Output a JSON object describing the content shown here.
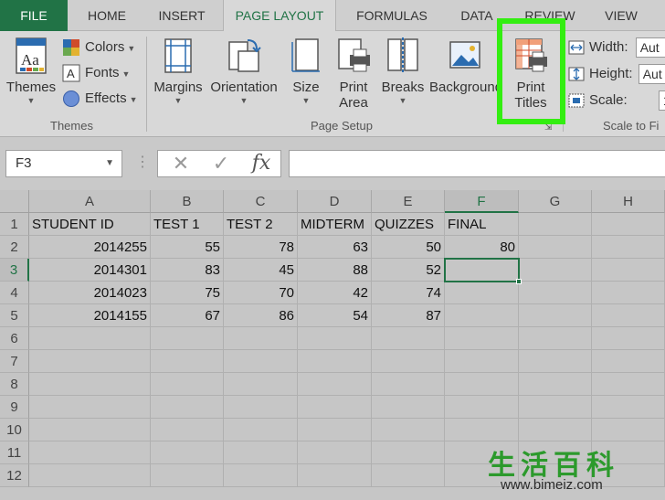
{
  "ribbon_tabs": [
    "FILE",
    "HOME",
    "INSERT",
    "PAGE LAYOUT",
    "FORMULAS",
    "DATA",
    "REVIEW",
    "VIEW"
  ],
  "active_tab": "PAGE LAYOUT",
  "themes_group": {
    "themes_label": "Themes",
    "colors_label": "Colors",
    "fonts_label": "Fonts",
    "effects_label": "Effects",
    "group_label": "Themes"
  },
  "page_setup_group": {
    "margins_label": "Margins",
    "orientation_label": "Orientation",
    "size_label": "Size",
    "print_area_line1": "Print",
    "print_area_line2": "Area",
    "breaks_label": "Breaks",
    "background_label": "Background",
    "print_titles_line1": "Print",
    "print_titles_line2": "Titles",
    "group_label": "Page Setup"
  },
  "scale_group": {
    "width_label": "Width:",
    "width_value": "Aut",
    "height_label": "Height:",
    "height_value": "Aut",
    "scale_label": "Scale:",
    "scale_value": "1",
    "group_label": "Scale to Fi"
  },
  "formula_bar": {
    "name_box": "F3",
    "cancel_symbol": "✕",
    "enter_symbol": "✓",
    "fx_symbol": "fx",
    "content": ""
  },
  "sheet": {
    "columns": [
      "A",
      "B",
      "C",
      "D",
      "E",
      "F",
      "G",
      "H"
    ],
    "selected_column": "F",
    "rows": [
      "1",
      "2",
      "3",
      "4",
      "5",
      "6",
      "7",
      "8",
      "9",
      "10",
      "11",
      "12"
    ],
    "selected_row": "3",
    "headers": [
      "STUDENT ID",
      "TEST 1",
      "TEST 2",
      "MIDTERM",
      "QUIZZES",
      "FINAL"
    ],
    "records": [
      [
        "2014255",
        "55",
        "78",
        "63",
        "50",
        "80"
      ],
      [
        "2014301",
        "83",
        "45",
        "88",
        "52",
        ""
      ],
      [
        "2014023",
        "75",
        "70",
        "42",
        "74",
        ""
      ],
      [
        "2014155",
        "67",
        "86",
        "54",
        "87",
        ""
      ]
    ]
  },
  "watermark": {
    "chars": "生活百科",
    "url": "www.bimeiz.com"
  },
  "colors": {
    "excel_green": "#217346",
    "highlight_green": "#33ee11"
  }
}
